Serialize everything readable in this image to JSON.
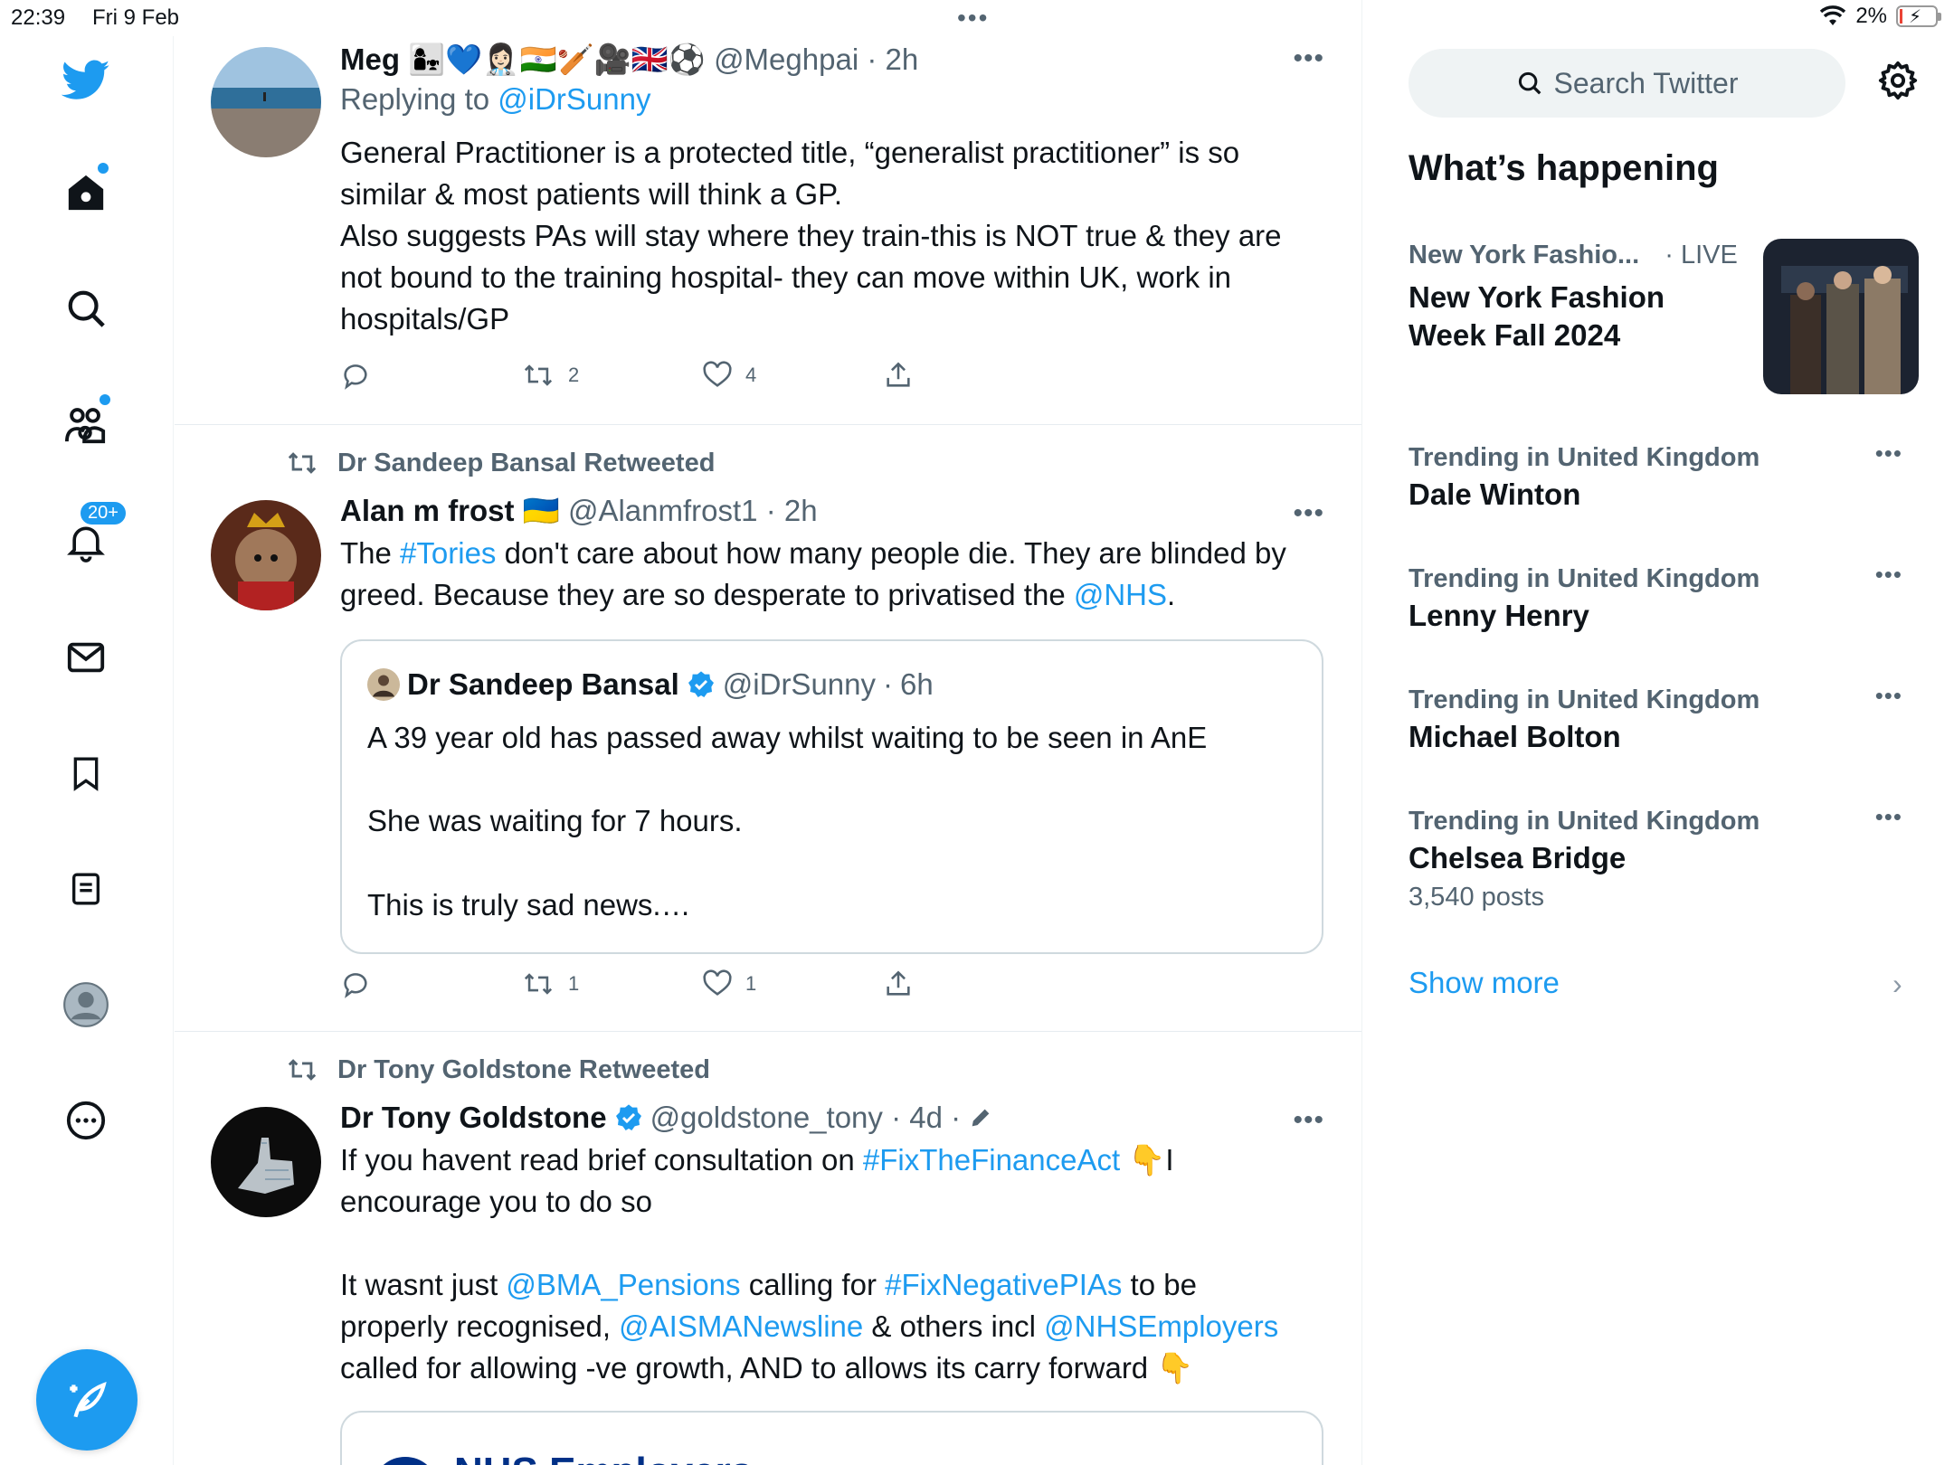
{
  "status_bar": {
    "time": "22:39",
    "date": "Fri 9 Feb",
    "battery": "2%"
  },
  "nav": {
    "notifications_badge": "20+"
  },
  "tweets": [
    {
      "name": "Meg",
      "emojis": "👩‍👧💙👩🏻‍⚕️🇮🇳🏏🎥🇬🇧⚽",
      "handle": "@Meghpai",
      "sep": " · ",
      "time": "2h",
      "replying_prefix": "Replying to ",
      "replying_to": "@iDrSunny",
      "lines": [
        "General Practitioner is a protected title, “generalist practitioner” is so",
        "similar & most patients will think a GP.",
        "Also suggests PAs will stay where they train-this is NOT true & they are",
        "not bound to the training hospital- they can move within UK, work in",
        "hospitals/GP"
      ],
      "retweets": "2",
      "likes": "4"
    },
    {
      "retweeted_by": "Dr Sandeep Bansal Retweeted",
      "name": "Alan m frost",
      "flag": "🇺🇦",
      "handle": "@Alanmfrost1",
      "sep": " · ",
      "time": "2h",
      "l1_a": "The ",
      "l1_link": "#Tories",
      "l1_b": " don't care about how many people die. They are blinded by",
      "l2_a": "greed. Because they are so desperate to privatised the ",
      "l2_link": "@NHS",
      "l2_b": ".",
      "quote": {
        "name": "Dr Sandeep Bansal",
        "handle": "@iDrSunny",
        "sep": " · ",
        "time": "6h",
        "line1": "A 39 year old has passed away whilst waiting to be seen in AnE",
        "line2": "She was waiting for 7 hours.",
        "line3": "This is truly sad news.…"
      },
      "retweets": "1",
      "likes": "1"
    },
    {
      "retweeted_by": "Dr Tony Goldstone Retweeted",
      "name": "Dr Tony Goldstone",
      "handle": "@goldstone_tony",
      "sep": " · ",
      "time": "4d",
      "sep2": " · ",
      "l1_a": "If you havent read brief consultation on ",
      "l1_link": "#FixTheFinanceAct",
      "l1_b": " 👇I",
      "l2": "encourage you to do so",
      "l3_a": "It wasnt just ",
      "l3_link1": "@BMA_Pensions",
      "l3_b": " calling for ",
      "l3_link2": "#FixNegativePIAs",
      "l3_c": " to be",
      "l4_a": "properly recognised, ",
      "l4_link1": "@AISMANewsline",
      "l4_b": " & others incl ",
      "l4_link2": "@NHSEmployers",
      "l5": "called for allowing -ve growth, AND to allows its carry forward 👇",
      "card_text": "NHS Employers"
    }
  ],
  "right": {
    "search_placeholder": "Search Twitter",
    "whats_happening": "What’s happening",
    "featured": {
      "context": "New York Fashio...",
      "live": "· LIVE",
      "title_l1": "New York Fashion",
      "title_l2": "Week Fall 2024"
    },
    "trends": [
      {
        "context": "Trending in United Kingdom",
        "name": "Dale Winton"
      },
      {
        "context": "Trending in United Kingdom",
        "name": "Lenny Henry"
      },
      {
        "context": "Trending in United Kingdom",
        "name": "Michael Bolton"
      },
      {
        "context": "Trending in United Kingdom",
        "name": "Chelsea Bridge",
        "posts": "3,540 posts"
      }
    ],
    "show_more": "Show more"
  }
}
